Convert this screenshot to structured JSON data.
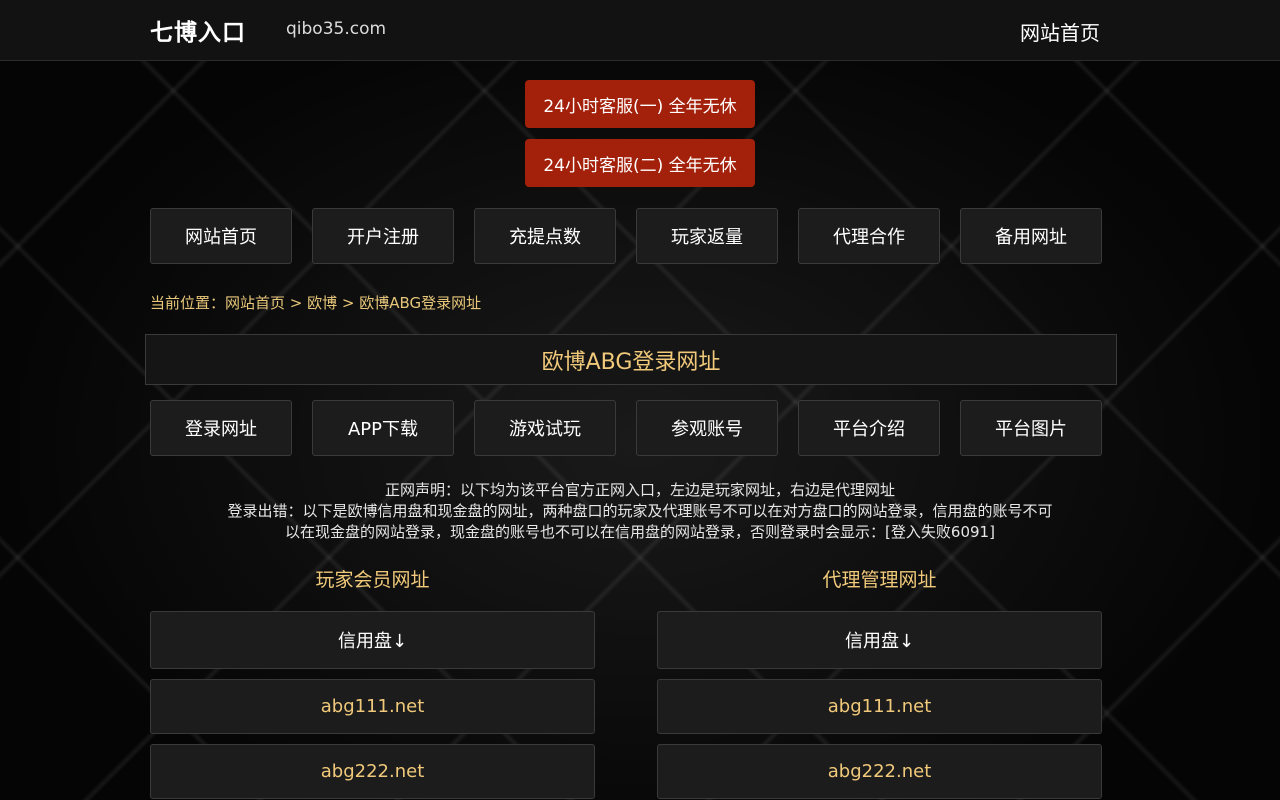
{
  "header": {
    "brand": "七博入口",
    "domain": "qibo35.com",
    "home_link": "网站首页"
  },
  "service_buttons": [
    {
      "label": "24小时客服(一) 全年无休"
    },
    {
      "label": "24小时客服(二) 全年无休"
    }
  ],
  "main_nav": [
    {
      "label": "网站首页"
    },
    {
      "label": "开户注册"
    },
    {
      "label": "充提点数"
    },
    {
      "label": "玩家返量"
    },
    {
      "label": "代理合作"
    },
    {
      "label": "备用网址"
    }
  ],
  "breadcrumb": {
    "prefix": "当前位置：",
    "home": "网站首页",
    "sep1": " > ",
    "category": "欧博",
    "sep2": " > ",
    "current": "欧博ABG登录网址"
  },
  "page_title": "欧博ABG登录网址",
  "sub_nav": [
    {
      "label": "登录网址"
    },
    {
      "label": "APP下载"
    },
    {
      "label": "游戏试玩"
    },
    {
      "label": "参观账号"
    },
    {
      "label": "平台介绍"
    },
    {
      "label": "平台图片"
    }
  ],
  "notice": {
    "line1": "正网声明：以下均为该平台官方正网入口，左边是玩家网址，右边是代理网址",
    "line2": "登录出错：以下是欧博信用盘和现金盘的网址，两种盘口的玩家及代理账号不可以在对方盘口的网站登录，信用盘的账号不可",
    "line3": "以在现金盘的网站登录，现金盘的账号也不可以在信用盘的网站登录，否则登录时会显示：[登入失败6091]"
  },
  "player_column": {
    "title": "玩家会员网址",
    "header": "信用盘↓",
    "links": [
      "abg111.net",
      "abg222.net"
    ]
  },
  "agent_column": {
    "title": "代理管理网址",
    "header": "信用盘↓",
    "links": [
      "abg111.net",
      "abg222.net"
    ]
  }
}
